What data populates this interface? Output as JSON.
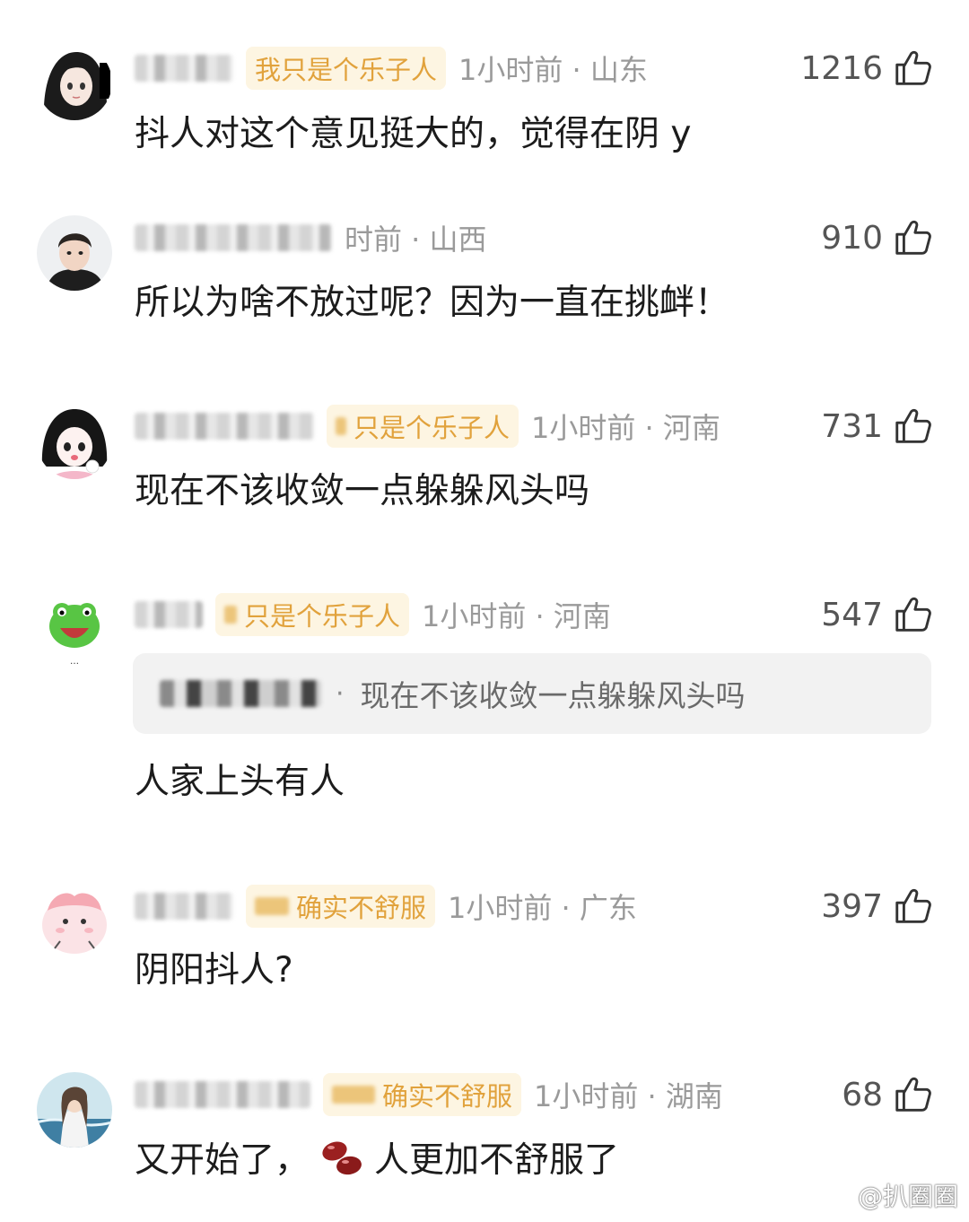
{
  "comments": [
    {
      "badge": "我只是个乐子人",
      "badge_has_blur": false,
      "meta": "1小时前 · 山东",
      "likes": "1216",
      "content": "抖人对这个意见挺大的，觉得在阴 y",
      "avatar": "avatar-anime-girl-dark-hair"
    },
    {
      "badge": "",
      "badge_has_blur": false,
      "meta": "时前 · 山西",
      "likes": "910",
      "content": "所以为啥不放过呢？因为一直在挑衅！",
      "avatar": "avatar-young-man"
    },
    {
      "badge": "只是个乐子人",
      "badge_has_blur": true,
      "meta": "1小时前 · 河南",
      "likes": "731",
      "content": "现在不该收敛一点躲躲风头吗",
      "avatar": "avatar-cartoon-girl"
    },
    {
      "badge": "只是个乐子人",
      "badge_has_blur": true,
      "meta": "1小时前 · 河南",
      "likes": "547",
      "quote": "现在不该收敛一点躲躲风头吗",
      "content": "人家上头有人",
      "avatar": "avatar-green-frog"
    },
    {
      "badge": "确实不舒服",
      "badge_has_blur": true,
      "meta": "1小时前 · 广东",
      "likes": "397",
      "content": "阴阳抖人?",
      "avatar": "avatar-pink-blob"
    },
    {
      "badge": "确实不舒服",
      "badge_has_blur": true,
      "meta": "1小时前 · 湖南",
      "likes": "68",
      "content_before": "又开始了，",
      "content_emoji": "beans-emoji",
      "content_after": "人更加不舒服了",
      "avatar": "avatar-anime-girl-sea"
    }
  ],
  "watermark": "@扒圈圈",
  "colors": {
    "badge_bg": "#fdf5e2",
    "badge_text": "#e1a23c",
    "meta_text": "#9a9a9a",
    "quote_bg": "#f2f2f2"
  }
}
